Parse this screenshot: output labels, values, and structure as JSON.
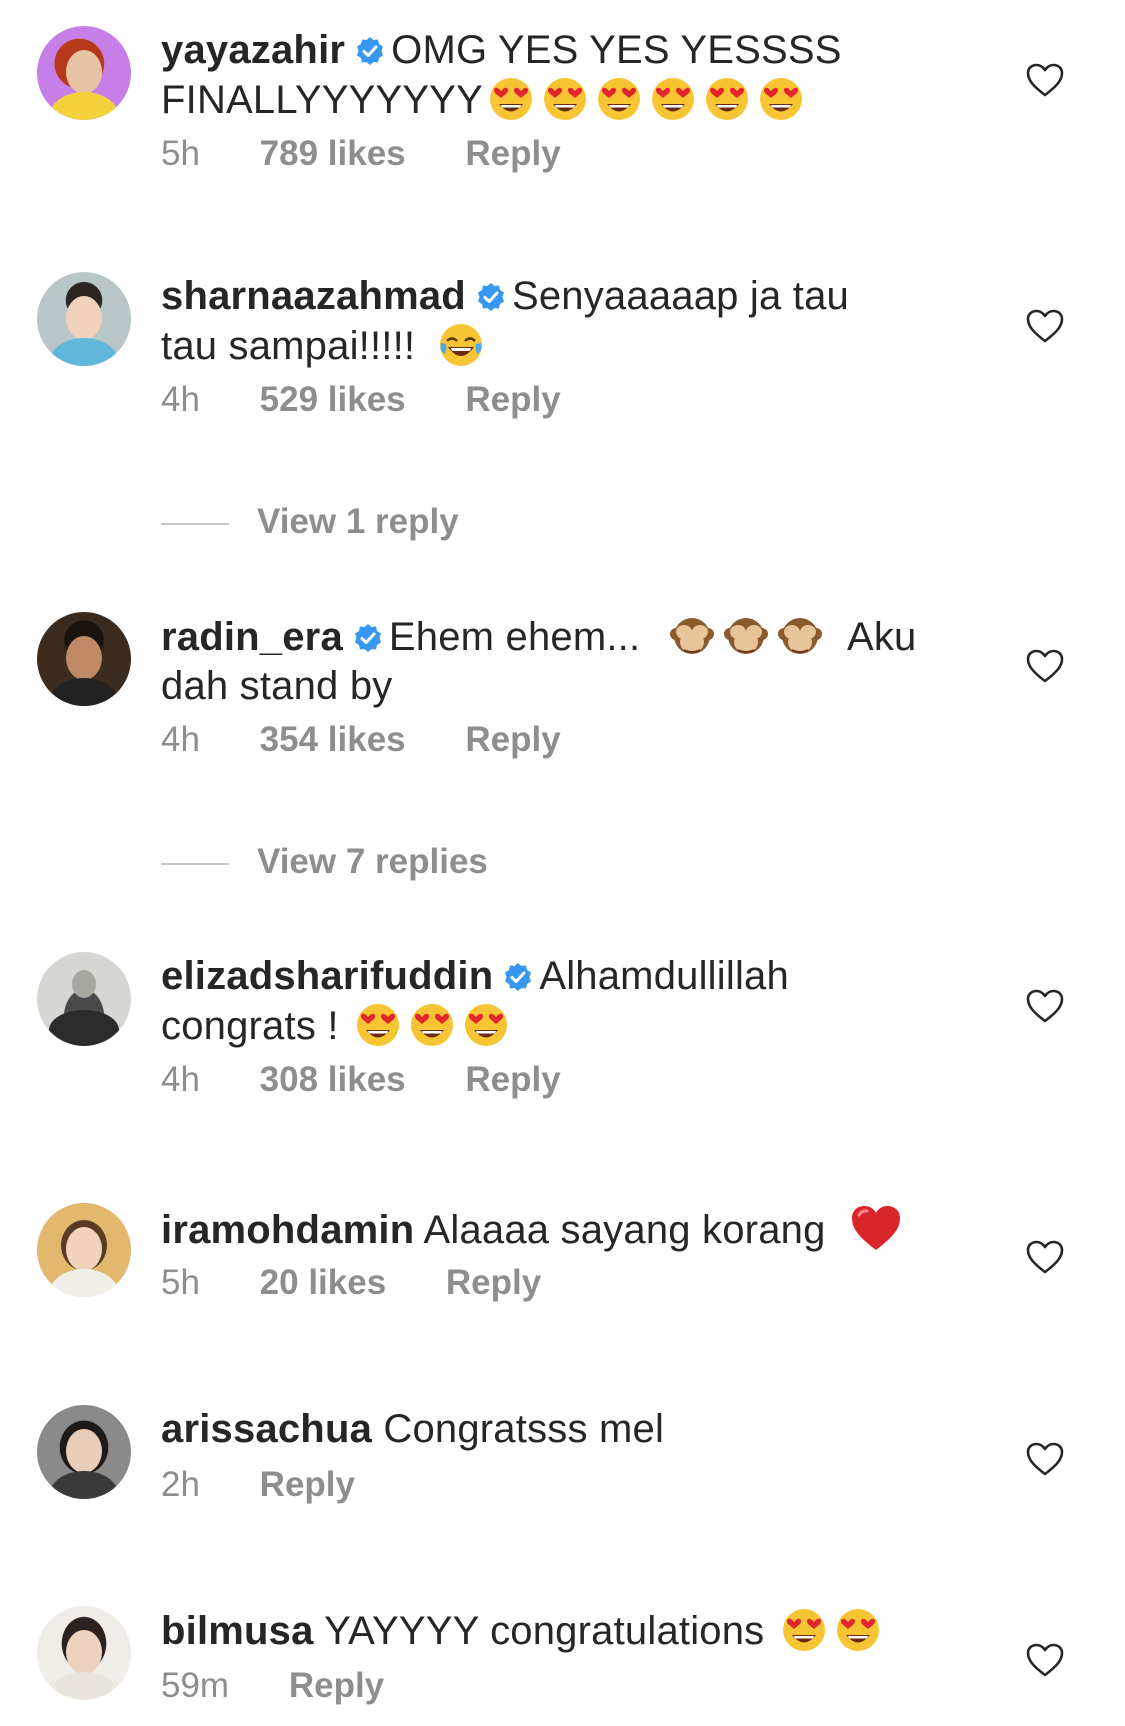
{
  "comments": [
    {
      "username": "yayazahir",
      "verified": true,
      "text_line1": "OMG YES YES YESSSS",
      "text_line2": "FINALLYYYYYYY",
      "emojis_line2": 6,
      "time": "5h",
      "likes": "789 likes",
      "reply": "Reply",
      "avatar_colors": {
        "bg": "#c77fe8",
        "hair": "#b5391a",
        "body": "#f3d23c"
      }
    },
    {
      "username": "sharnaazahmad",
      "verified": true,
      "text_line1": "Senyaaaaap ja tau",
      "text_line2": "tau sampai!!!!!",
      "emoji_line2": "joy-emoji",
      "time": "4h",
      "likes": "529 likes",
      "reply": "Reply",
      "view_replies": "View 1 reply",
      "avatar_colors": {
        "bg": "#b9c7c8",
        "hair": "#2a2520",
        "body": "#5fb8d9"
      }
    },
    {
      "username": "radin_era",
      "verified": true,
      "text_line1_pre": "Ehem ehem...",
      "text_line1_post": "Aku",
      "text_line2": "dah stand by",
      "emojis_line1": "see-no-evil-monkey-emoji",
      "time": "4h",
      "likes": "354 likes",
      "reply": "Reply",
      "view_replies": "View 7 replies",
      "avatar_colors": {
        "bg": "#3b2a1e",
        "hair": "#1a1410",
        "body": "#222222"
      }
    },
    {
      "username": "elizadsharifuddin",
      "verified": true,
      "text_line1": "Alhamdullillah",
      "text_line2": "congrats !",
      "emojis_line2": 3,
      "time": "4h",
      "likes": "308 likes",
      "reply": "Reply",
      "avatar_colors": {
        "bg": "#d6d6d2",
        "hair": "#2b2b2b",
        "body": "#4a4a4a"
      }
    },
    {
      "username": "iramohdamin",
      "verified": false,
      "text_line1": "Alaaaa sayang korang",
      "emoji_line1": "red-heart-emoji",
      "time": "5h",
      "likes": "20 likes",
      "reply": "Reply",
      "avatar_colors": {
        "bg": "#e2b76e",
        "hair": "#5a3a22",
        "body": "#f2efe8"
      }
    },
    {
      "username": "arissachua",
      "verified": false,
      "text_line1": "Congratsss mel",
      "time": "2h",
      "reply": "Reply",
      "avatar_colors": {
        "bg": "#8a8a8a",
        "hair": "#1e1a18",
        "body": "#3a3a3a"
      }
    },
    {
      "username": "bilmusa",
      "verified": false,
      "text_line1": "YAYYYY congratulations",
      "emojis_line1": 2,
      "time": "59m",
      "reply": "Reply",
      "avatar_colors": {
        "bg": "#f0ede8",
        "hair": "#2c2220",
        "body": "#e9e5de"
      }
    }
  ],
  "colors": {
    "verified_blue": "#3897f0",
    "meta_gray": "#8e8e8e",
    "text_dark": "#262626"
  }
}
